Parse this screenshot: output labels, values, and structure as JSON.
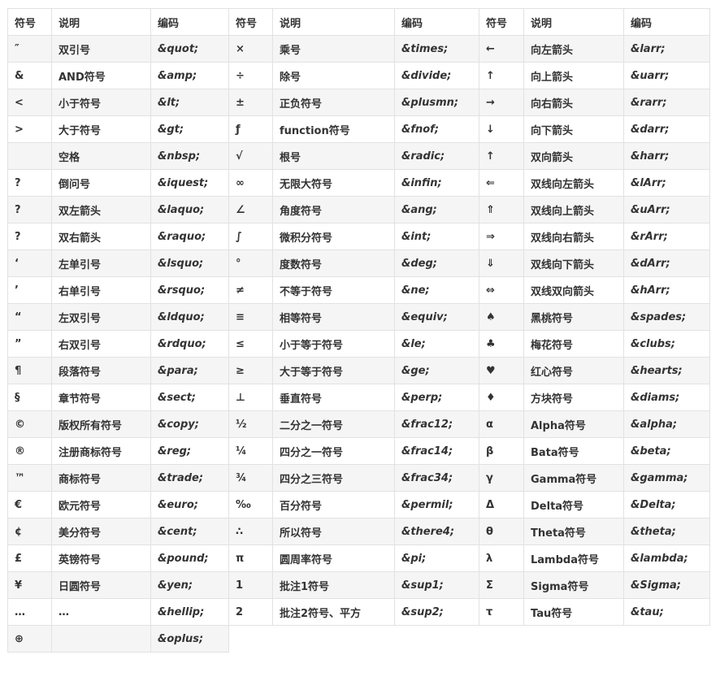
{
  "headers": [
    "符号",
    "说明",
    "编码",
    "符号",
    "说明",
    "编码",
    "符号",
    "说明",
    "编码"
  ],
  "rows": [
    [
      "″",
      "双引号",
      "&quot;",
      "×",
      "乘号",
      "&times;",
      "←",
      "向左箭头",
      "&larr;"
    ],
    [
      "&",
      "AND符号",
      "&amp;",
      "÷",
      "除号",
      "&divide;",
      "↑",
      "向上箭头",
      "&uarr;"
    ],
    [
      "<",
      "小于符号",
      "&lt;",
      "±",
      "正负符号",
      "&plusmn;",
      "→",
      "向右箭头",
      "&rarr;"
    ],
    [
      ">",
      "大于符号",
      "&gt;",
      "ƒ",
      "function符号",
      "&fnof;",
      "↓",
      "向下箭头",
      "&darr;"
    ],
    [
      "",
      "空格",
      "&nbsp;",
      "√",
      "根号",
      "&radic;",
      "↑",
      "双向箭头",
      "&harr;"
    ],
    [
      "?",
      "倒问号",
      "&iquest;",
      "∞",
      "无限大符号",
      "&infin;",
      "⇐",
      "双线向左箭头",
      "&lArr;"
    ],
    [
      "?",
      "双左箭头",
      "&laquo;",
      "∠",
      "角度符号",
      "&ang;",
      "⇑",
      "双线向上箭头",
      "&uArr;"
    ],
    [
      "?",
      "双右箭头",
      "&raquo;",
      "∫",
      "微积分符号",
      "&int;",
      "⇒",
      "双线向右箭头",
      "&rArr;"
    ],
    [
      "‘",
      "左单引号",
      "&lsquo;",
      "°",
      "度数符号",
      "&deg;",
      "⇓",
      "双线向下箭头",
      "&dArr;"
    ],
    [
      "’",
      "右单引号",
      "&rsquo;",
      "≠",
      "不等于符号",
      "&ne;",
      "⇔",
      "双线双向箭头",
      "&hArr;"
    ],
    [
      "“",
      "左双引号",
      "&ldquo;",
      "≡",
      "相等符号",
      "&equiv;",
      "♠",
      "黑桃符号",
      "&spades;"
    ],
    [
      "”",
      "右双引号",
      "&rdquo;",
      "≤",
      "小于等于符号",
      "&le;",
      "♣",
      "梅花符号",
      "&clubs;"
    ],
    [
      "¶",
      "段落符号",
      "&para;",
      "≥",
      "大于等于符号",
      "&ge;",
      "♥",
      "红心符号",
      "&hearts;"
    ],
    [
      "§",
      "章节符号",
      "&sect;",
      "⊥",
      "垂直符号",
      "&perp;",
      "♦",
      "方块符号",
      "&diams;"
    ],
    [
      "©",
      "版权所有符号",
      "&copy;",
      "½",
      "二分之一符号",
      "&frac12;",
      "α",
      "Alpha符号",
      "&alpha;"
    ],
    [
      "®",
      "注册商标符号",
      "&reg;",
      "¼",
      "四分之一符号",
      "&frac14;",
      "β",
      "Bata符号",
      "&beta;"
    ],
    [
      "™",
      "商标符号",
      "&trade;",
      "¾",
      "四分之三符号",
      "&frac34;",
      "γ",
      "Gamma符号",
      "&gamma;"
    ],
    [
      "€",
      "欧元符号",
      "&euro;",
      "‰",
      "百分符号",
      "&permil;",
      "Δ",
      "Delta符号",
      "&Delta;"
    ],
    [
      "¢",
      "美分符号",
      "&cent;",
      "∴",
      "所以符号",
      "&there4;",
      "θ",
      "Theta符号",
      "&theta;"
    ],
    [
      "£",
      "英镑符号",
      "&pound;",
      "π",
      "圆周率符号",
      "&pi;",
      "λ",
      "Lambda符号",
      "&lambda;"
    ],
    [
      "¥",
      "日圆符号",
      "&yen;",
      "1",
      "批注1符号",
      "&sup1;",
      "Σ",
      "Sigma符号",
      "&Sigma;"
    ],
    [
      "…",
      "…",
      "&hellip;",
      "2",
      "批注2符号、平方",
      "&sup2;",
      "τ",
      "Tau符号",
      "&tau;"
    ]
  ],
  "last_row": [
    "⊕",
    "",
    "&oplus;"
  ]
}
